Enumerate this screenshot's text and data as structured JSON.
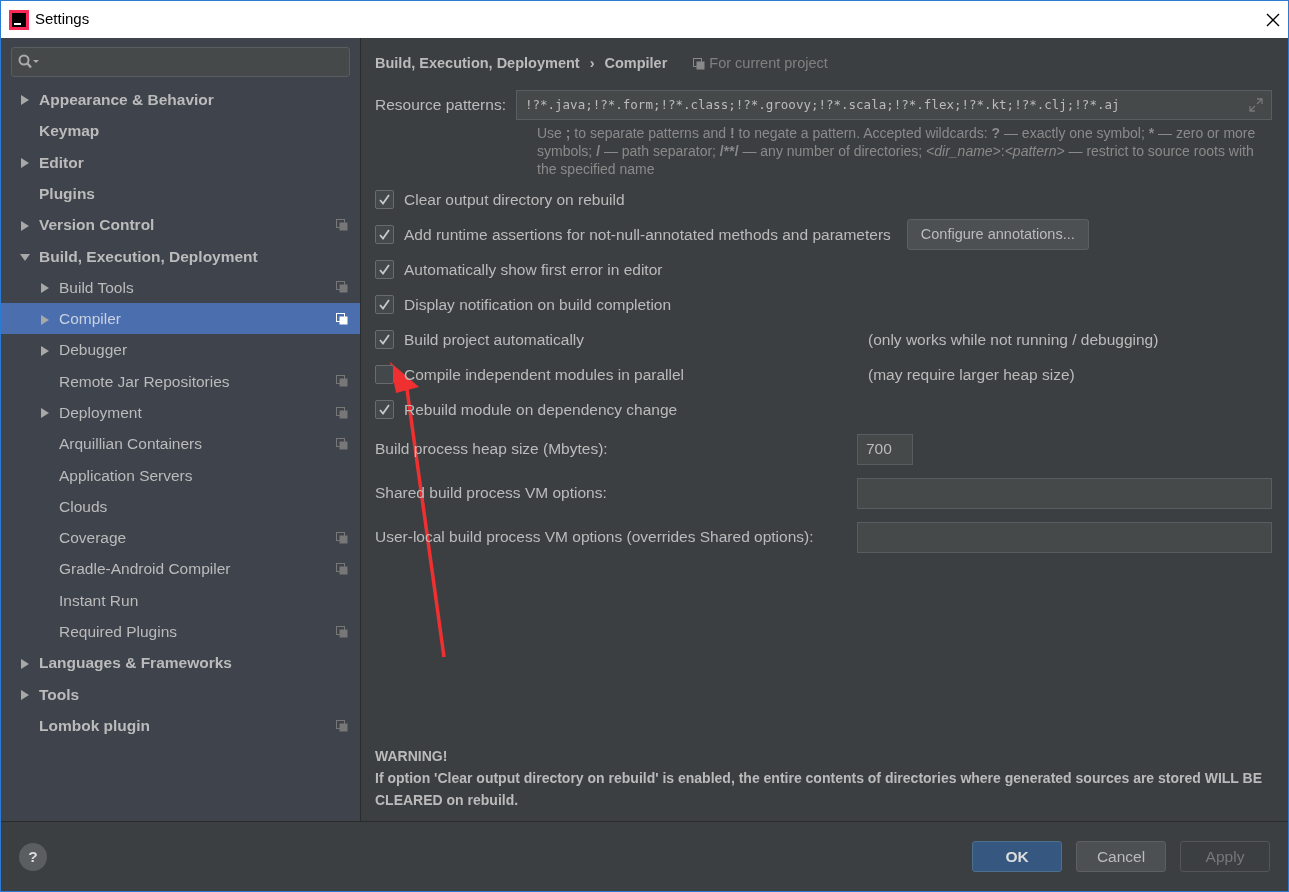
{
  "window": {
    "title": "Settings"
  },
  "sidebar": {
    "items": [
      {
        "label": "Appearance & Behavior",
        "expanded": false,
        "selected": false,
        "project_scope": false
      },
      {
        "label": "Keymap",
        "selected": false,
        "project_scope": false
      },
      {
        "label": "Editor",
        "expanded": false,
        "selected": false,
        "project_scope": false
      },
      {
        "label": "Plugins",
        "selected": false,
        "project_scope": false
      },
      {
        "label": "Version Control",
        "expanded": false,
        "selected": false,
        "project_scope": true
      },
      {
        "label": "Build, Execution, Deployment",
        "expanded": true,
        "selected": false,
        "project_scope": false,
        "children": [
          {
            "label": "Build Tools",
            "expanded": false,
            "selected": false,
            "project_scope": true
          },
          {
            "label": "Compiler",
            "expanded": false,
            "selected": true,
            "project_scope": true
          },
          {
            "label": "Debugger",
            "expanded": false,
            "selected": false,
            "project_scope": false
          },
          {
            "label": "Remote Jar Repositories",
            "selected": false,
            "project_scope": true
          },
          {
            "label": "Deployment",
            "expanded": false,
            "selected": false,
            "project_scope": true
          },
          {
            "label": "Arquillian Containers",
            "selected": false,
            "project_scope": true
          },
          {
            "label": "Application Servers",
            "selected": false,
            "project_scope": false
          },
          {
            "label": "Clouds",
            "selected": false,
            "project_scope": false
          },
          {
            "label": "Coverage",
            "selected": false,
            "project_scope": true
          },
          {
            "label": "Gradle-Android Compiler",
            "selected": false,
            "project_scope": true
          },
          {
            "label": "Instant Run",
            "selected": false,
            "project_scope": false
          },
          {
            "label": "Required Plugins",
            "selected": false,
            "project_scope": true
          }
        ]
      },
      {
        "label": "Languages & Frameworks",
        "expanded": false,
        "selected": false,
        "project_scope": false
      },
      {
        "label": "Tools",
        "expanded": false,
        "selected": false,
        "project_scope": false
      },
      {
        "label": "Lombok plugin",
        "selected": false,
        "project_scope": true
      }
    ]
  },
  "breadcrumb": {
    "parent": "Build, Execution, Deployment",
    "separator": "›",
    "current": "Compiler",
    "scope": "For current project"
  },
  "resource_patterns": {
    "label": "Resource patterns:",
    "value": "!?*.java;!?*.form;!?*.class;!?*.groovy;!?*.scala;!?*.flex;!?*.kt;!?*.clj;!?*.aj",
    "hint": [
      {
        "text": "Use ",
        "kind": "text"
      },
      {
        "text": ";",
        "kind": "symbol"
      },
      {
        "text": " to separate patterns and ",
        "kind": "text"
      },
      {
        "text": "!",
        "kind": "symbol"
      },
      {
        "text": " to negate a pattern. Accepted wildcards: ",
        "kind": "text"
      },
      {
        "text": "?",
        "kind": "symbol"
      },
      {
        "text": " — exactly one symbol; ",
        "kind": "text"
      },
      {
        "text": "*",
        "kind": "symbol"
      },
      {
        "text": " — zero or more symbols; ",
        "kind": "text"
      },
      {
        "text": "/",
        "kind": "symbol"
      },
      {
        "text": " — path separator; ",
        "kind": "text"
      },
      {
        "text": "/**/",
        "kind": "symbol"
      },
      {
        "text": " — any number of directories; ",
        "kind": "text"
      },
      {
        "text": "<dir_name>",
        "kind": "placeholder"
      },
      {
        "text": ":",
        "kind": "text"
      },
      {
        "text": "<pattern>",
        "kind": "placeholder"
      },
      {
        "text": " — restrict to source roots with the specified name",
        "kind": "text"
      }
    ]
  },
  "options": [
    {
      "label": "Clear output directory on rebuild",
      "checked": true
    },
    {
      "label": "Add runtime assertions for not-null-annotated methods and parameters",
      "checked": true,
      "button": "Configure annotations..."
    },
    {
      "label": "Automatically show first error in editor",
      "checked": true
    },
    {
      "label": "Display notification on build completion",
      "checked": true
    },
    {
      "label": "Build project automatically",
      "checked": true,
      "note": "(only works while not running / debugging)"
    },
    {
      "label": "Compile independent modules in parallel",
      "checked": false,
      "note": "(may require larger heap size)"
    },
    {
      "label": "Rebuild module on dependency change",
      "checked": true
    }
  ],
  "fields": [
    {
      "label": "Build process heap size (Mbytes):",
      "value": "700",
      "kind": "short"
    },
    {
      "label": "Shared build process VM options:",
      "kind": "wide"
    },
    {
      "label": "User-local build process VM options (overrides Shared options):",
      "kind": "wide"
    }
  ],
  "warning": {
    "title": "WARNING!",
    "text": "If option 'Clear output directory on rebuild' is enabled, the entire contents of directories where generated sources are stored WILL BE CLEARED on rebuild."
  },
  "footer": {
    "help": "?",
    "buttons": [
      {
        "label": "OK",
        "kind": "primary",
        "disabled": false
      },
      {
        "label": "Cancel",
        "kind": "default",
        "disabled": false
      },
      {
        "label": "Apply",
        "kind": "default",
        "disabled": true
      }
    ]
  }
}
